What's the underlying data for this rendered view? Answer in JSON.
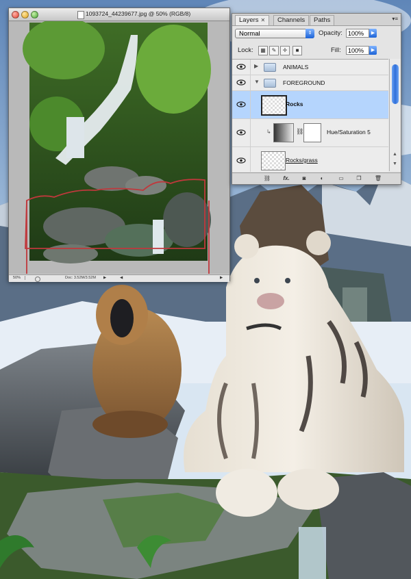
{
  "document": {
    "title": "1093724_44239677.jpg @ 50% (RGB/8)",
    "status_zoom": "50%",
    "status_doc": "Doc: 3.52M/3.52M"
  },
  "panel": {
    "tabs": [
      {
        "label": "Layers"
      },
      {
        "label": "Channels"
      },
      {
        "label": "Paths"
      }
    ],
    "blend_mode": "Normal",
    "opacity_label": "Opacity:",
    "opacity_value": "100%",
    "lock_label": "Lock:",
    "fill_label": "Fill:",
    "fill_value": "100%",
    "layers": [
      {
        "name": "ANIMALS",
        "kind": "group",
        "expanded": false
      },
      {
        "name": "FOREGROUND",
        "kind": "group",
        "expanded": true
      },
      {
        "name": "Rocks",
        "kind": "layer",
        "selected": true
      },
      {
        "name": "Hue/Saturation 5",
        "kind": "adjustment"
      },
      {
        "name": "Rocks/grass",
        "kind": "layer"
      }
    ],
    "bottom_icons": [
      "link-icon",
      "fx-icon",
      "mask-icon",
      "adjustment-icon",
      "folder-icon",
      "new-layer-icon",
      "trash-icon"
    ],
    "fx_label": "fx."
  },
  "colors": {
    "selection": "#b5d5fd",
    "accent_blue": "#1c63d6",
    "selection_outline": "#c0383c"
  }
}
